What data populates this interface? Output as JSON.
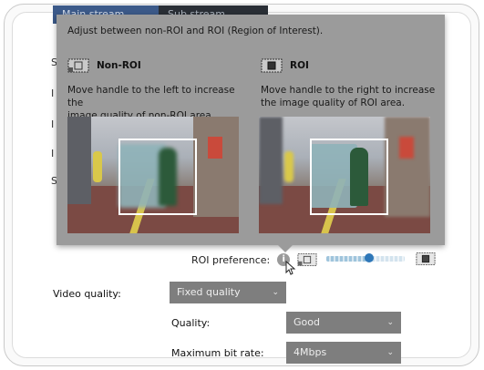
{
  "tabs": [
    {
      "label": "Main stream"
    },
    {
      "label": "Sub stream"
    }
  ],
  "left_letters": [
    "S",
    "I",
    "I",
    "I",
    "S"
  ],
  "popover": {
    "title": "Adjust between non-ROI and ROI (Region of Interest).",
    "non_roi": {
      "heading": "Non-ROI",
      "line1": "Move handle to the left to increase the",
      "line2": "image quality of non-ROI area."
    },
    "roi": {
      "heading": "ROI",
      "line1": "Move handle to the right to increase",
      "line2": "the image quality of ROI area."
    }
  },
  "roi_preference": {
    "label": "ROI preference:",
    "info_icon": "i",
    "slider_level": 0.55
  },
  "video_quality": {
    "label": "Video quality:",
    "value": "Fixed quality"
  },
  "quality": {
    "label": "Quality:",
    "value": "Good"
  },
  "max_bitrate": {
    "label": "Maximum bit rate:",
    "value": "4Mbps"
  },
  "colors": {
    "popover_bg": "#9b9b9b",
    "select_bg": "#7e7e7e",
    "slider_knob": "#2e77b8"
  }
}
